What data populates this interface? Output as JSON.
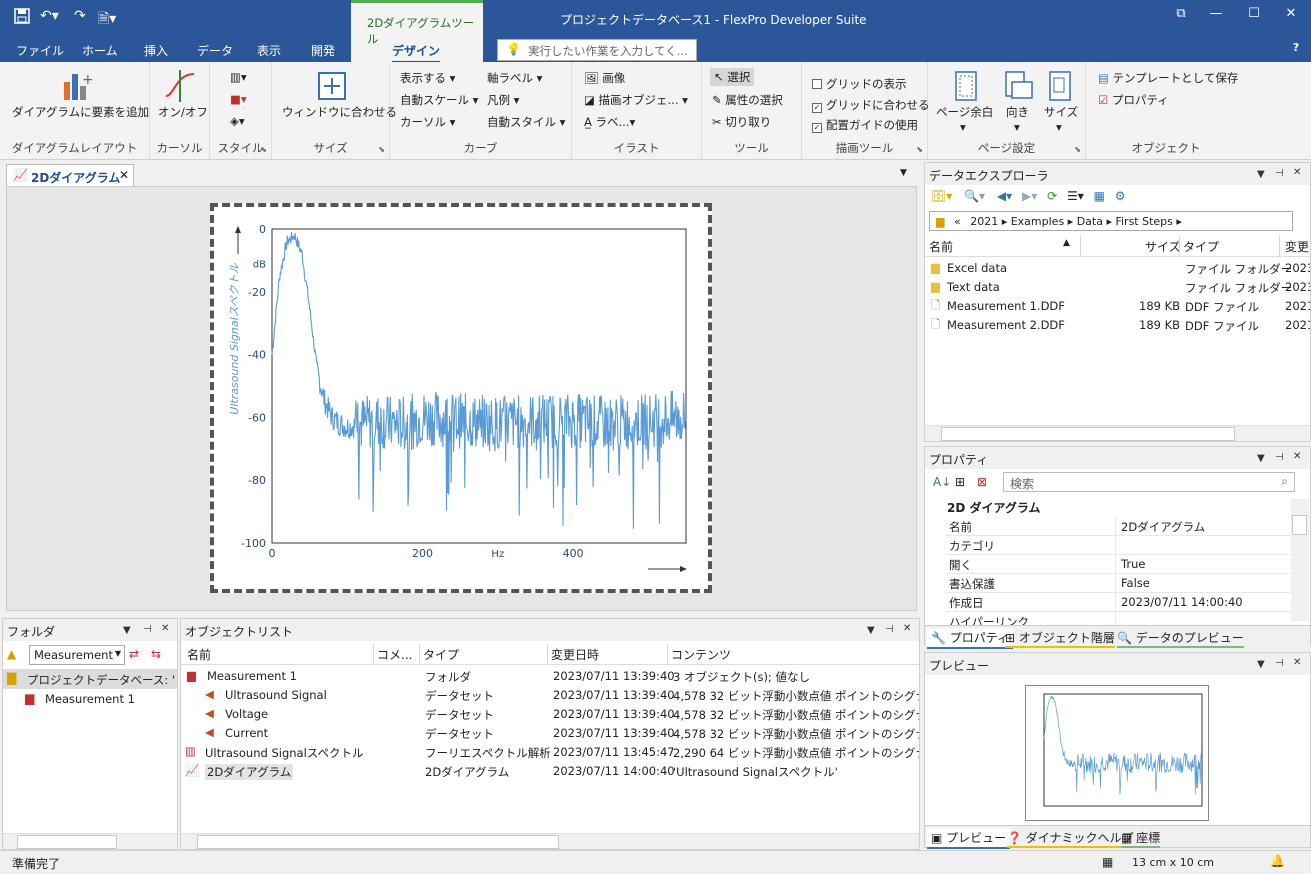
{
  "title": "プロジェクトデータベース1 - FlexPro Developer Suite",
  "context_tab": "2Dダイアグラムツール",
  "menu": [
    "ファイル",
    "ホーム",
    "挿入",
    "データ",
    "表示",
    "開発"
  ],
  "design_tab": "デザイン",
  "tell_me": "実行したい作業を入力してく...",
  "ribbon": {
    "layout": {
      "add": "ダイアグラムに要素を追加",
      "label": "ダイアグラムレイアウト"
    },
    "cursor": {
      "onoff": "オン/オフ",
      "label": "カーソル"
    },
    "style": {
      "label": "スタイル"
    },
    "size": {
      "fit": "ウィンドウに合わせる",
      "label": "サイズ"
    },
    "curve": {
      "show": "表示する",
      "autoscale": "自動スケール",
      "cursor": "カーソル",
      "axislabel": "軸ラベル",
      "legend": "凡例",
      "autostyle": "自動スタイル",
      "label": "カーブ"
    },
    "illust": {
      "image": "画像",
      "drawobj": "描画オブジェ...",
      "label_btn": "ラベ...",
      "label": "イラスト"
    },
    "tools": {
      "select": "選択",
      "attr": "属性の選択",
      "cut": "切り取り",
      "label": "ツール"
    },
    "draw": {
      "grid": "グリッドの表示",
      "snap": "グリッドに合わせる",
      "guide": "配置ガイドの使用",
      "label": "描画ツール"
    },
    "page": {
      "margin": "ページ余白",
      "orient": "向き",
      "size": "サイズ",
      "label": "ページ設定"
    },
    "object": {
      "template": "テンプレートとして保存",
      "props": "プロパティ",
      "label": "オブジェクト"
    }
  },
  "doc_tab": "2Dダイアグラム",
  "chart_data": {
    "type": "line",
    "ylabel": "Ultrasound Signalスペクトル",
    "yunit": "dB",
    "xunit": "Hz",
    "xlim": [
      0,
      550
    ],
    "ylim": [
      -100,
      0
    ],
    "xticks": [
      "0",
      "200",
      "400"
    ],
    "yticks": [
      "0",
      "-20",
      "-40",
      "-60",
      "-80",
      "-100"
    ],
    "x": [
      0,
      10,
      20,
      30,
      40,
      50,
      60,
      70,
      80,
      90,
      100,
      120,
      140,
      160,
      180,
      200,
      250,
      300,
      350,
      400,
      450,
      500,
      550
    ],
    "y": [
      -40,
      -15,
      -4,
      -2,
      -8,
      -25,
      -45,
      -55,
      -60,
      -62,
      -63,
      -62,
      -61,
      -62,
      -62,
      -60,
      -61,
      -62,
      -61,
      -61,
      -62,
      -61,
      -60
    ]
  },
  "explorer": {
    "title": "データエクスプローラ",
    "path": [
      "«",
      "2021",
      "Examples",
      "Data",
      "First Steps"
    ],
    "cols": [
      "名前",
      "サイズ",
      "タイプ",
      "変更"
    ],
    "rows": [
      {
        "name": "Excel data",
        "size": "",
        "type": "ファイル フォルダー",
        "date": "2023"
      },
      {
        "name": "Text data",
        "size": "",
        "type": "ファイル フォルダー",
        "date": "2023"
      },
      {
        "name": "Measurement 1.DDF",
        "size": "189 KB",
        "type": "DDF ファイル",
        "date": "2021"
      },
      {
        "name": "Measurement 2.DDF",
        "size": "189 KB",
        "type": "DDF ファイル",
        "date": "2021"
      }
    ]
  },
  "props": {
    "title": "プロパティ",
    "search": "検索",
    "section": "2D ダイアグラム",
    "rows": [
      {
        "k": "名前",
        "v": "2Dダイアグラム"
      },
      {
        "k": "カテゴリ",
        "v": ""
      },
      {
        "k": "開く",
        "v": "True"
      },
      {
        "k": "書込保護",
        "v": "False"
      },
      {
        "k": "作成日",
        "v": "2023/07/11 14:00:40"
      },
      {
        "k": "ハイパーリンク",
        "v": ""
      }
    ],
    "tabs": [
      "プロパティ",
      "オブジェクト階層",
      "データのプレビュー"
    ]
  },
  "preview": {
    "title": "プレビュー",
    "tabs": [
      "プレビュー",
      "ダイナミックヘルプ",
      "座標"
    ]
  },
  "folder": {
    "title": "フォルダ",
    "select": "Measurement",
    "items": [
      "プロジェクトデータベース: 'プロジェ",
      "Measurement 1"
    ]
  },
  "objlist": {
    "title": "オブジェクトリスト",
    "cols": [
      "名前",
      "コメ...",
      "タイプ",
      "変更日時",
      "コンテンツ"
    ],
    "rows": [
      {
        "name": "Measurement 1",
        "type": "フォルダ",
        "date": "2023/07/11 13:39:40",
        "content": "3 オブジェクト(s); 値なし"
      },
      {
        "name": "Ultrasound Signal",
        "type": "データセット",
        "date": "2023/07/11 13:39:40",
        "content": "4,578 32 ビット浮動小数点値 ポイントのシグナル [V,"
      },
      {
        "name": "Voltage",
        "type": "データセット",
        "date": "2023/07/11 13:39:40",
        "content": "4,578 32 ビット浮動小数点値 ポイントのシグナル [V,"
      },
      {
        "name": "Current",
        "type": "データセット",
        "date": "2023/07/11 13:39:40",
        "content": "4,578 32 ビット浮動小数点値 ポイントのシグナル [m"
      },
      {
        "name": "Ultrasound Signalスペクトル",
        "type": "フーリエスペクトル解析",
        "date": "2023/07/11 13:45:47",
        "content": "2,290 64 ビット浮動小数点値 ポイントのシグナル [dE"
      },
      {
        "name": "2Dダイアグラム",
        "type": "2Dダイアグラム",
        "date": "2023/07/11 14:00:40",
        "content": "'Ultrasound Signalスペクトル'"
      }
    ]
  },
  "status": {
    "left": "準備完了",
    "size": "13 cm x 10 cm"
  },
  "colors": {
    "accent": "#2b579a",
    "line": "#5b9bd5",
    "ctx": "#4caf50"
  }
}
